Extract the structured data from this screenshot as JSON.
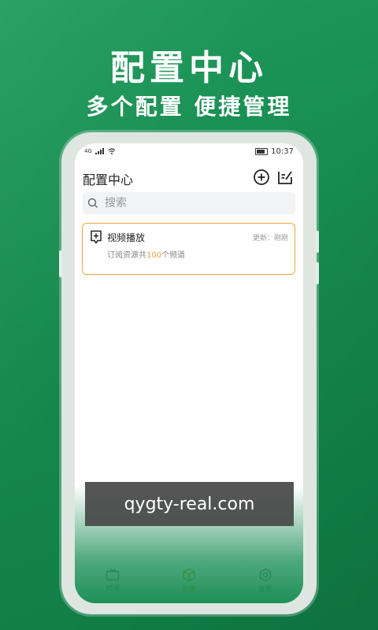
{
  "promo": {
    "title": "配置中心",
    "subtitle": "多个配置 便捷管理"
  },
  "status_bar": {
    "signal": "4G",
    "time": "10:37"
  },
  "app": {
    "title": "配置中心",
    "icons": {
      "add": "add-circle-icon",
      "edit": "edit-note-icon"
    }
  },
  "search": {
    "placeholder": "搜索",
    "icon": "search-icon"
  },
  "configs": [
    {
      "title": "视频播放",
      "updated_label": "更新：",
      "updated_value": "刚刚",
      "desc_prefix": "订阅资源共",
      "count": "100",
      "desc_suffix": "个频道",
      "icon": "add-box-icon"
    }
  ],
  "bottom_nav": [
    {
      "label": "频道",
      "icon": "tv-icon",
      "active": false
    },
    {
      "label": "配置",
      "icon": "cube-icon",
      "active": true
    },
    {
      "label": "设置",
      "icon": "gear-icon",
      "active": false
    }
  ],
  "watermark": "qygty-real.com",
  "colors": {
    "background_green": "#168a4f",
    "accent_orange": "#f0a53a",
    "active_nav": "#e0a800"
  }
}
